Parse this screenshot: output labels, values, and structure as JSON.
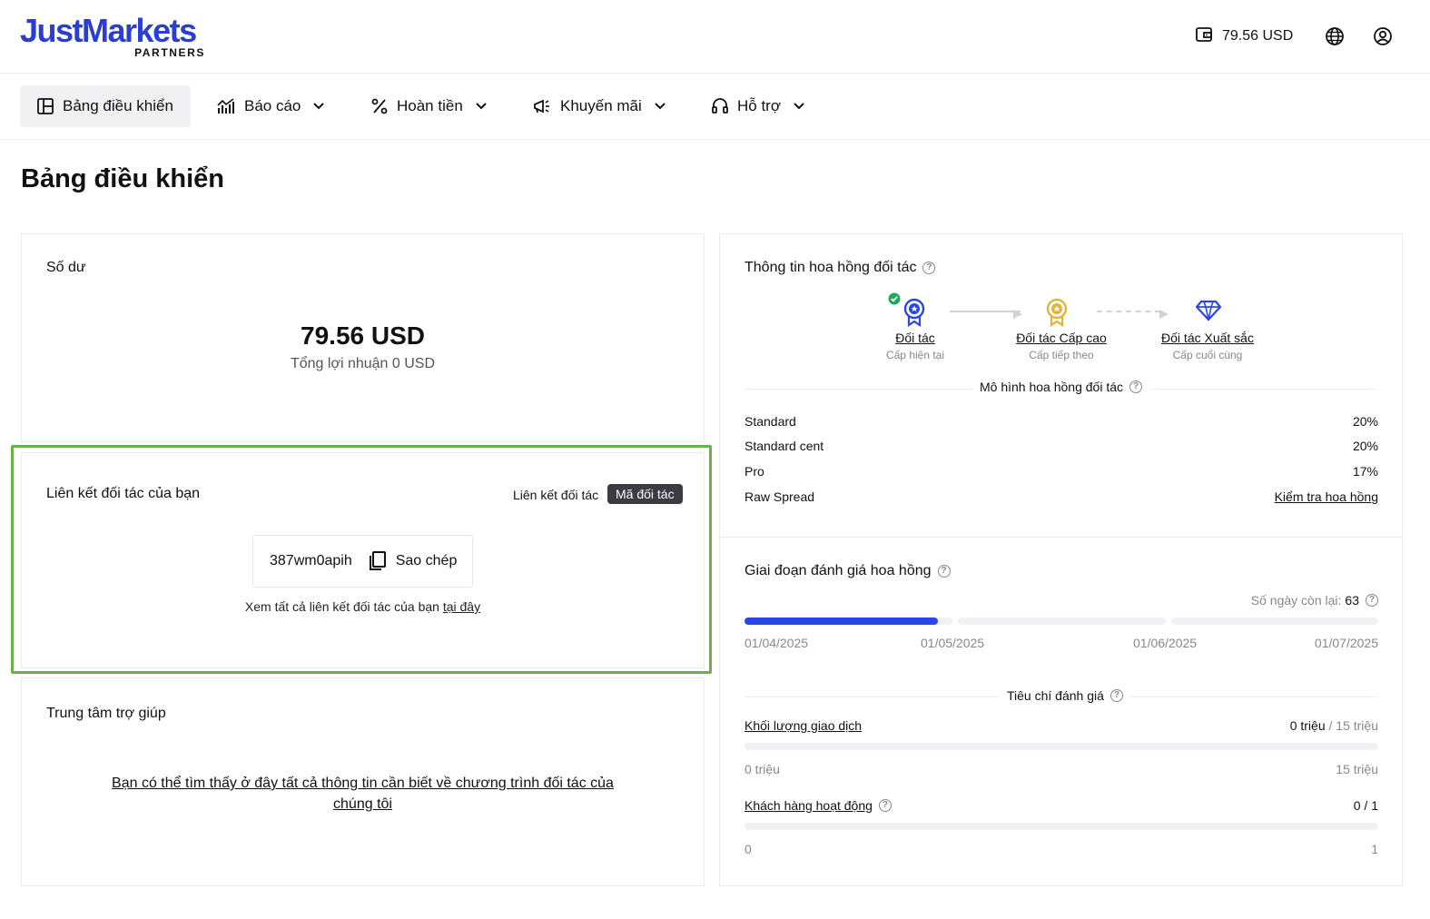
{
  "header": {
    "logo_main": "JustMarkets",
    "logo_sub": "PARTNERS",
    "balance": "79.56 USD",
    "icons": [
      "wallet-icon",
      "globe-icon",
      "user-icon"
    ]
  },
  "nav": {
    "items": [
      {
        "label": "Bảng điều khiển",
        "icon": "dashboard-icon",
        "active": true
      },
      {
        "label": "Báo cáo",
        "icon": "chart-icon"
      },
      {
        "label": "Hoàn tiền",
        "icon": "percent-icon"
      },
      {
        "label": "Khuyến mãi",
        "icon": "megaphone-icon"
      },
      {
        "label": "Hỗ trợ",
        "icon": "headset-icon"
      }
    ]
  },
  "page_title": "Bảng điều khiển",
  "balance_card": {
    "title": "Số dư",
    "amount": "79.56 USD",
    "profit": "Tổng lợi nhuận 0 USD"
  },
  "link_card": {
    "title": "Liên kết đối tác của bạn",
    "tab_link": "Liên kết đối tác",
    "tab_code": "Mã đối tác",
    "code": "387wm0apih",
    "copy_label": "Sao chép",
    "see_all_prefix": "Xem tất cả liên kết đối tác của bạn",
    "see_all_link": "tại đây"
  },
  "help_card": {
    "title": "Trung tâm trợ giúp",
    "link_line1": "Bạn có thể tìm thấy ở đây tất cả thông tin cần biết về chương trình đối tác của",
    "link_line2": "chúng tôi"
  },
  "commission_card": {
    "title": "Thông tin hoa hồng đối tác",
    "tiers": [
      {
        "name": "Đối tác",
        "sub": "Cấp hiện tại"
      },
      {
        "name": "Đối tác Cấp cao",
        "sub": "Cấp tiếp theo"
      },
      {
        "name": "Đối tác Xuất sắc",
        "sub": "Cấp cuối cùng"
      }
    ],
    "model_label": "Mô hình hoa hồng đối tác",
    "rows": [
      {
        "name": "Standard",
        "value": "20%"
      },
      {
        "name": "Standard cent",
        "value": "20%"
      },
      {
        "name": "Pro",
        "value": "17%"
      },
      {
        "name": "Raw Spread",
        "value": "Kiểm tra hoa hồng"
      }
    ]
  },
  "evaluation_card": {
    "title": "Giai đoạn đánh giá hoa hồng",
    "days_left_label": "Số ngày còn lại:",
    "days_left": "63",
    "progress_fraction": 0.305,
    "dates": [
      "01/04/2025",
      "01/05/2025",
      "01/06/2025",
      "01/07/2025"
    ],
    "criteria_label": "Tiêu chí đánh giá",
    "volume": {
      "label": "Khối lượng giao dịch",
      "current": "0 triệu",
      "target": "/ 15 triệu",
      "min": "0 triệu",
      "max": "15 triệu"
    },
    "clients": {
      "label": "Khách hàng hoạt động",
      "value": "0 / 1",
      "min": "0",
      "max": "1"
    }
  },
  "colors": {
    "brand": "#2a3ed6",
    "progress": "#2a46e8",
    "highlight": "#6ab04c",
    "gold": "#e5b33a",
    "success": "#1fa85b"
  }
}
